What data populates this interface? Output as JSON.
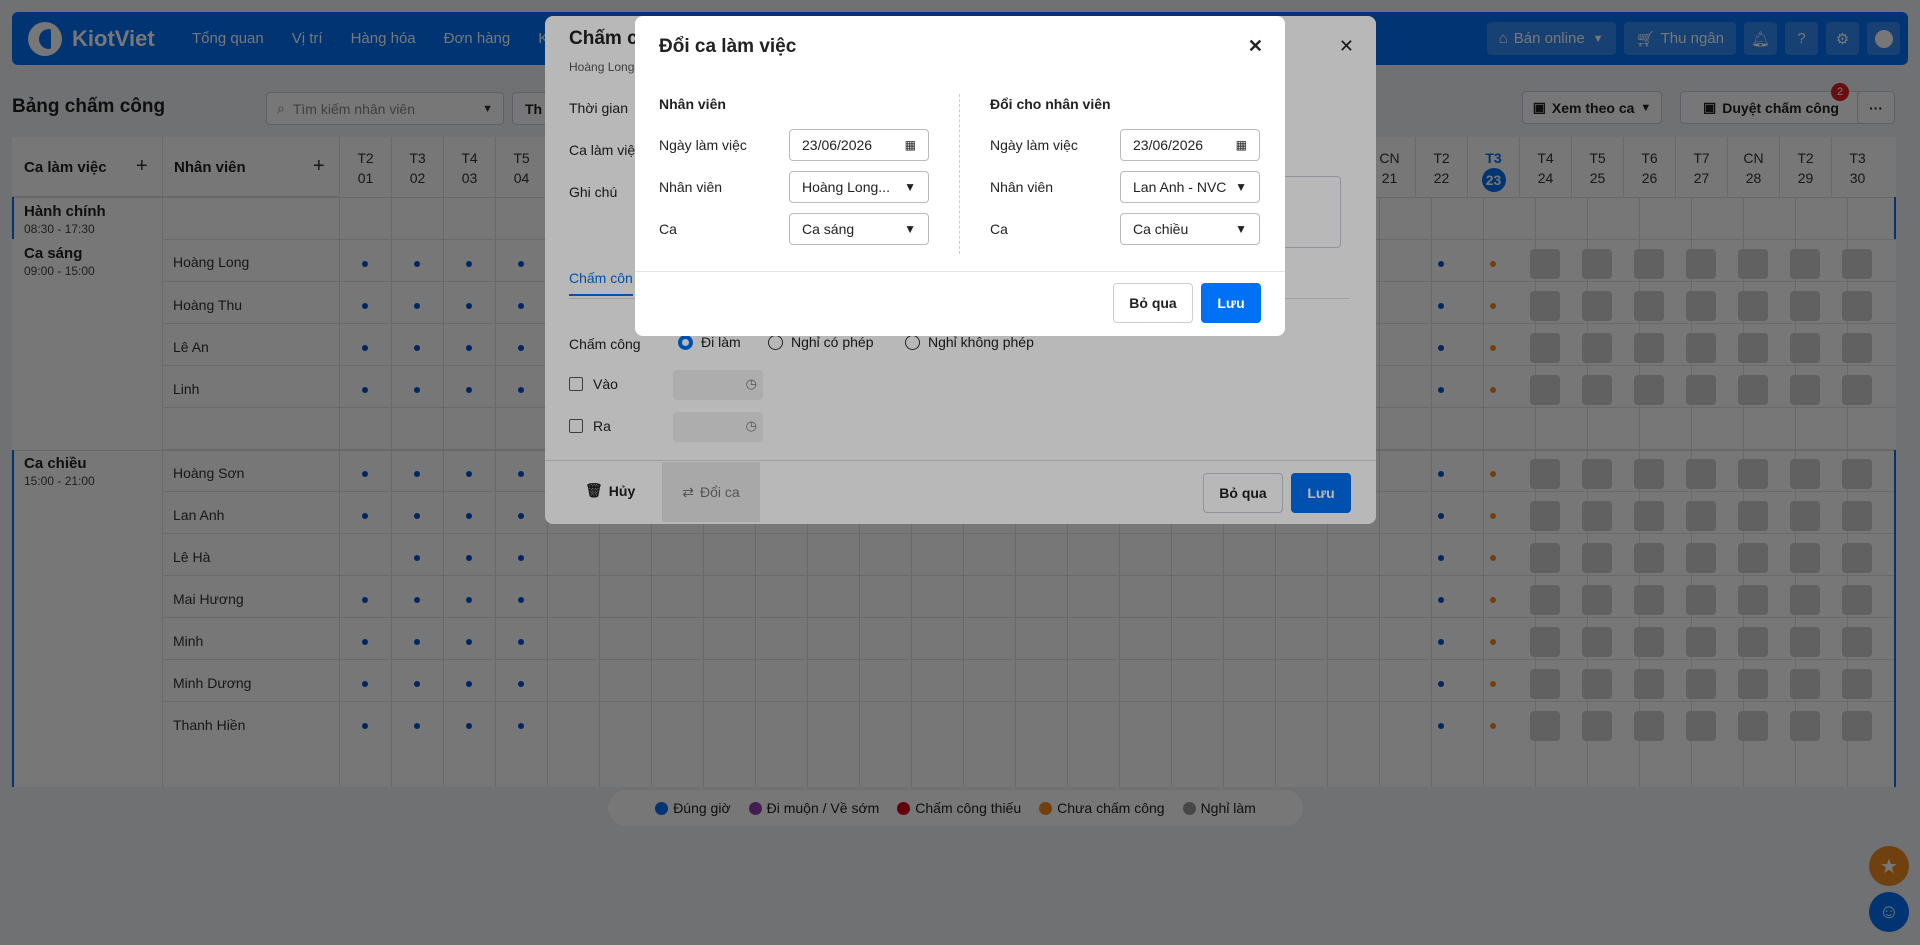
{
  "app": {
    "name": "KiotViet"
  },
  "nav": [
    "Tổng quan",
    "Vị trí",
    "Hàng hóa",
    "Đơn hàng",
    "Khác"
  ],
  "topright": {
    "online": "Bán online",
    "cashier": "Thu ngân"
  },
  "page": {
    "title": "Bảng chấm công",
    "search_placeholder": "Tìm kiếm nhân viên",
    "filter_label": "Th",
    "view_label": "Xem theo ca",
    "approve_label": "Duyệt chấm công",
    "approve_badge": "2"
  },
  "grid": {
    "shift_header": "Ca làm việc",
    "employee_header": "Nhân viên",
    "days": [
      {
        "dow": "T2",
        "d": "01"
      },
      {
        "dow": "T3",
        "d": "02"
      },
      {
        "dow": "T4",
        "d": "03"
      },
      {
        "dow": "T5",
        "d": "04"
      },
      {
        "dow": "CN",
        "d": "21"
      },
      {
        "dow": "T2",
        "d": "22"
      },
      {
        "dow": "T3",
        "d": "23"
      },
      {
        "dow": "T4",
        "d": "24"
      },
      {
        "dow": "T5",
        "d": "25"
      },
      {
        "dow": "T6",
        "d": "26"
      },
      {
        "dow": "T7",
        "d": "27"
      },
      {
        "dow": "CN",
        "d": "28"
      },
      {
        "dow": "T2",
        "d": "29"
      },
      {
        "dow": "T3",
        "d": "30"
      }
    ],
    "shifts": [
      {
        "name": "Hành chính",
        "time": "08:30 - 17:30"
      },
      {
        "name": "Ca sáng",
        "time": "09:00 - 15:00"
      },
      {
        "name": "Ca chiều",
        "time": "15:00 - 21:00"
      }
    ],
    "employees": [
      "Hoàng Long",
      "Hoàng Thu",
      "Lê An",
      "Linh",
      "Hoàng Sơn",
      "Lan Anh",
      "Lê Hà",
      "Mai Hương",
      "Minh",
      "Minh Dương",
      "Thanh Hiền"
    ]
  },
  "legend": [
    {
      "label": "Đúng giờ",
      "color": "#0070f4"
    },
    {
      "label": "Đi muộn / Về sớm",
      "color": "#8e44ad"
    },
    {
      "label": "Chấm công thiếu",
      "color": "#d0021b"
    },
    {
      "label": "Chưa chấm công",
      "color": "#f08a20"
    },
    {
      "label": "Nghỉ làm",
      "color": "#999999"
    }
  ],
  "modal_attendance": {
    "title": "Chấm c",
    "subtitle": "Hoàng Long",
    "time_label": "Thời gian",
    "shift_label": "Ca làm việ",
    "note_label": "Ghi chú",
    "tab": "Chấm côn",
    "attendance_label": "Chấm công",
    "opt_work": "Đi làm",
    "opt_leave_paid": "Nghỉ có phép",
    "opt_leave_unpaid": "Nghỉ không phép",
    "in_label": "Vào",
    "out_label": "Ra",
    "cancel_label": "Hủy",
    "swap_label": "Đổi ca",
    "skip_label": "Bỏ qua",
    "save_label": "Lưu"
  },
  "modal_swap": {
    "title": "Đổi ca làm việc",
    "left": {
      "heading": "Nhân viên",
      "date_label": "Ngày làm việc",
      "date": "23/06/2026",
      "emp_label": "Nhân viên",
      "emp": "Hoàng Long...",
      "shift_label": "Ca",
      "shift": "Ca sáng"
    },
    "right": {
      "heading": "Đổi cho nhân viên",
      "date_label": "Ngày làm việc",
      "date": "23/06/2026",
      "emp_label": "Nhân viên",
      "emp": "Lan Anh - NVC",
      "shift_label": "Ca",
      "shift": "Ca chiều"
    },
    "skip_label": "Bỏ qua",
    "save_label": "Lưu"
  }
}
